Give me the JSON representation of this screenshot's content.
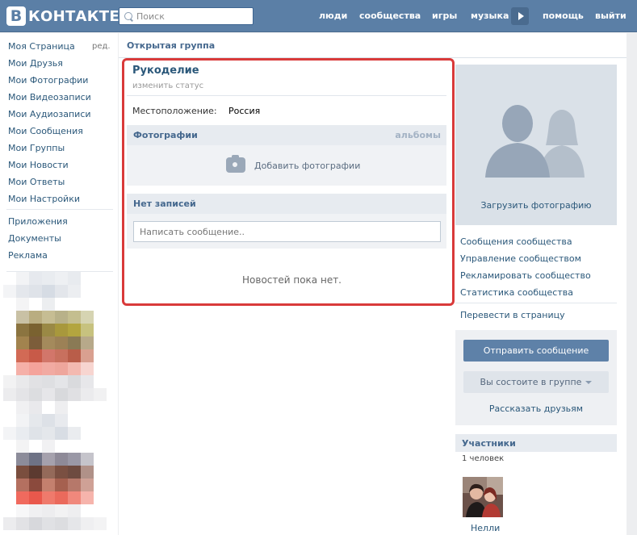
{
  "header": {
    "logo_letter": "В",
    "logo_text": "КОНТАКТЕ",
    "search_placeholder": "Поиск",
    "nav": [
      "люди",
      "сообщества",
      "игры",
      "музыка",
      "помощь",
      "выйти"
    ]
  },
  "sidebar": {
    "edit_label": "ред.",
    "items": [
      "Моя Страница",
      "Мои Друзья",
      "Мои Фотографии",
      "Мои Видеозаписи",
      "Мои Аудиозаписи",
      "Мои Сообщения",
      "Мои Группы",
      "Мои Новости",
      "Мои Ответы",
      "Мои Настройки"
    ],
    "extra_items": [
      "Приложения",
      "Документы",
      "Реклама"
    ]
  },
  "group": {
    "type": "Открытая группа",
    "name": "Рукоделие",
    "status_link": "изменить статус",
    "location_label": "Местоположение:",
    "location_value": "Россия"
  },
  "photos": {
    "title": "Фотографии",
    "albums_link": "альбомы",
    "add_label": "Добавить фотографии"
  },
  "wall": {
    "title": "Нет записей",
    "input_placeholder": "Написать сообщение..",
    "empty_text": "Новостей пока нет."
  },
  "right": {
    "upload_photo": "Загрузить фотографию",
    "links": [
      "Сообщения сообщества",
      "Управление сообществом",
      "Рекламировать сообщество",
      "Статистика сообщества"
    ],
    "convert_link": "Перевести в страницу",
    "send_message": "Отправить сообщение",
    "member_status": "Вы состоите в группе",
    "tell_friends": "Рассказать друзьям",
    "members_title": "Участники",
    "members_count": "1 человек",
    "member_name": "Нелли"
  },
  "colors": {
    "header": "#5b7fa6",
    "link": "#2b587a",
    "highlight_border": "#d93a3a"
  }
}
